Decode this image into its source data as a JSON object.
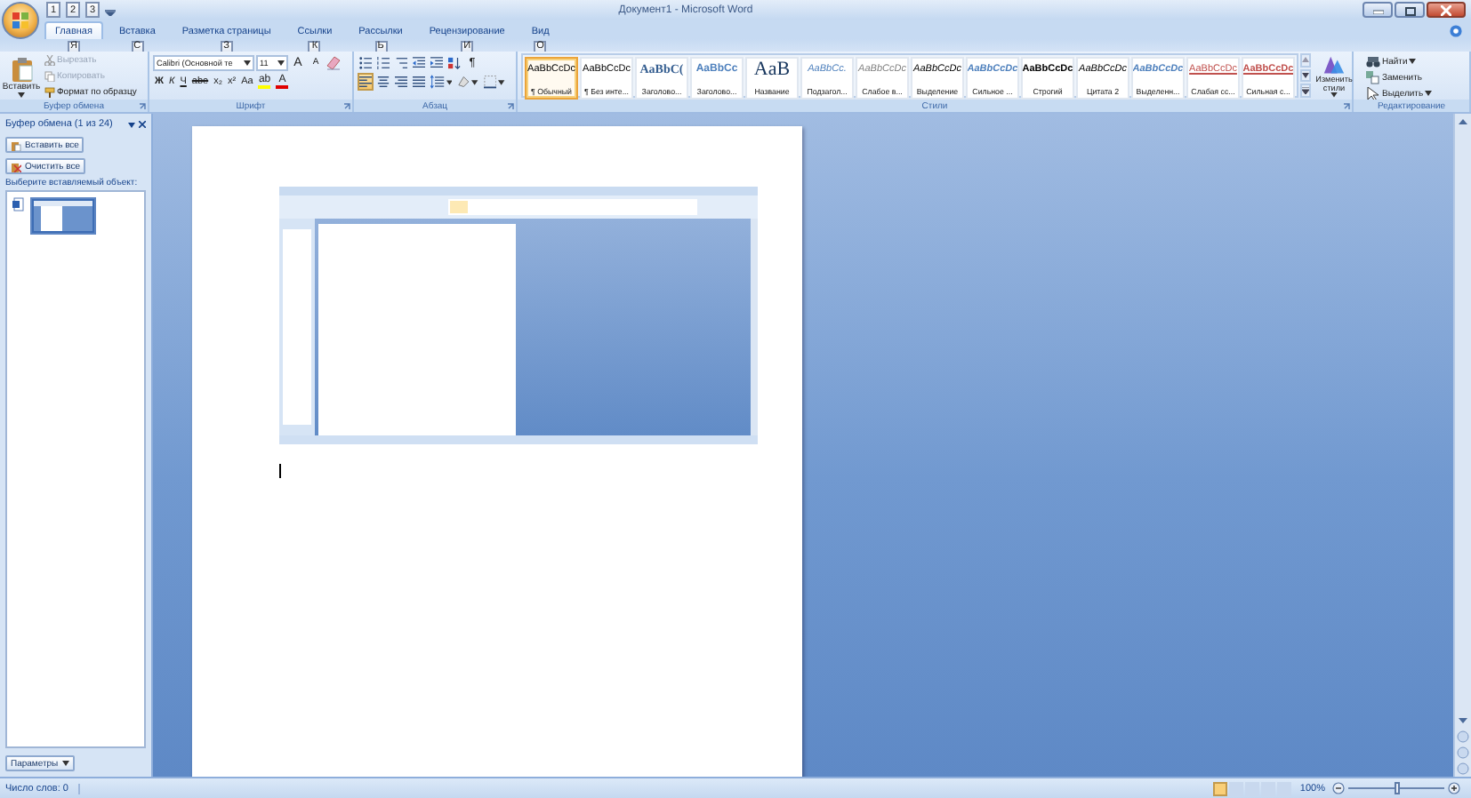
{
  "title_bar": {
    "title": "Документ1 - Microsoft Word",
    "quick_access_keys": [
      "1",
      "2",
      "3"
    ]
  },
  "tabs": [
    {
      "label": "Главная",
      "key": "Я",
      "selected": true
    },
    {
      "label": "Вставка",
      "key": "С",
      "selected": false
    },
    {
      "label": "Разметка страницы",
      "key": "З",
      "selected": false
    },
    {
      "label": "Ссылки",
      "key": "К",
      "selected": false
    },
    {
      "label": "Рассылки",
      "key": "Ь",
      "selected": false
    },
    {
      "label": "Рецензирование",
      "key": "И",
      "selected": false
    },
    {
      "label": "Вид",
      "key": "О",
      "selected": false
    }
  ],
  "ribbon": {
    "clipboard": {
      "label": "Буфер обмена",
      "paste": "Вставить",
      "items": [
        {
          "label": "Вырезать",
          "disabled": true
        },
        {
          "label": "Копировать",
          "disabled": true
        },
        {
          "label": "Формат по образцу",
          "disabled": false
        }
      ]
    },
    "font": {
      "label": "Шрифт",
      "font_name": "Calibri (Основной те",
      "font_size": "11",
      "size_buttons": [
        "A",
        "A"
      ],
      "format_buttons": [
        {
          "label": "Ж",
          "kind": "bold"
        },
        {
          "label": "К",
          "kind": "italic"
        },
        {
          "label": "Ч",
          "kind": "underline"
        },
        {
          "label": "abe",
          "kind": "strike"
        },
        {
          "label": "x₂",
          "kind": "plain"
        },
        {
          "label": "x²",
          "kind": "plain"
        },
        {
          "label": "Aa",
          "kind": "plain"
        }
      ],
      "color_buttons": [
        {
          "label": "ab",
          "color": "#ffff00"
        },
        {
          "label": "A",
          "color": "#e00000"
        }
      ]
    },
    "paragraph": {
      "label": "Абзац",
      "pilcrow": "¶",
      "align_buttons": [
        {
          "selected": true
        },
        {
          "selected": false
        },
        {
          "selected": false
        },
        {
          "selected": false
        }
      ]
    },
    "styles": {
      "label": "Стили",
      "change_styles": "Изменить стили",
      "items": [
        {
          "sample": "AaBbCcDc",
          "name": "¶ Обычный",
          "kind": "plain",
          "color": "#000000",
          "selected": true
        },
        {
          "sample": "AaBbCcDc",
          "name": "¶ Без инте...",
          "kind": "plain",
          "color": "#000000",
          "selected": false
        },
        {
          "sample": "AaBbC(",
          "name": "Заголово...",
          "kind": "heading",
          "color": "#365f91",
          "selected": false
        },
        {
          "sample": "AaBbCc",
          "name": "Заголово...",
          "kind": "heading2",
          "color": "#4f81bd",
          "selected": false
        },
        {
          "sample": "AaB",
          "name": "Название",
          "kind": "title",
          "color": "#17365d",
          "selected": false
        },
        {
          "sample": "AaBbCc.",
          "name": "Подзагол...",
          "kind": "italic",
          "color": "#4f81bd",
          "selected": false
        },
        {
          "sample": "AaBbCcDc",
          "name": "Слабое в...",
          "kind": "italic",
          "color": "#808080",
          "selected": false
        },
        {
          "sample": "AaBbCcDc",
          "name": "Выделение",
          "kind": "italic",
          "color": "#000000",
          "selected": false
        },
        {
          "sample": "AaBbCcDc",
          "name": "Сильное ...",
          "kind": "bold-italic",
          "color": "#4f81bd",
          "selected": false
        },
        {
          "sample": "AaBbCcDc",
          "name": "Строгий",
          "kind": "bold",
          "color": "#000000",
          "selected": false
        },
        {
          "sample": "AaBbCcDc",
          "name": "Цитата 2",
          "kind": "italic",
          "color": "#000000",
          "selected": false
        },
        {
          "sample": "AaBbCcDc",
          "name": "Выделенн...",
          "kind": "bold-italic",
          "color": "#4f81bd",
          "selected": false
        },
        {
          "sample": "AaBbCcDc",
          "name": "Слабая сс...",
          "kind": "underline",
          "color": "#c0504d",
          "selected": false
        },
        {
          "sample": "AaBbCcDc",
          "name": "Сильная с...",
          "kind": "bold-underline",
          "color": "#c0504d",
          "selected": false
        }
      ]
    },
    "editing": {
      "label": "Редактирование",
      "items": [
        {
          "label": "Найти",
          "kind": "menu"
        },
        {
          "label": "Заменить",
          "kind": "plain"
        },
        {
          "label": "Выделить",
          "kind": "menu"
        }
      ]
    }
  },
  "clipboard_pane": {
    "title": "Буфер обмена (1 из 24)",
    "buttons": [
      "Вставить все",
      "Очистить все"
    ],
    "prompt": "Выберите вставляемый объект:",
    "options": "Параметры"
  },
  "status_bar": {
    "words": "Число слов: 0",
    "view_buttons": [
      {
        "selected": true
      },
      {
        "selected": false
      },
      {
        "selected": false
      },
      {
        "selected": false
      },
      {
        "selected": false
      }
    ],
    "zoom": "100%",
    "zoom_slider": {
      "level": 0.5
    }
  }
}
